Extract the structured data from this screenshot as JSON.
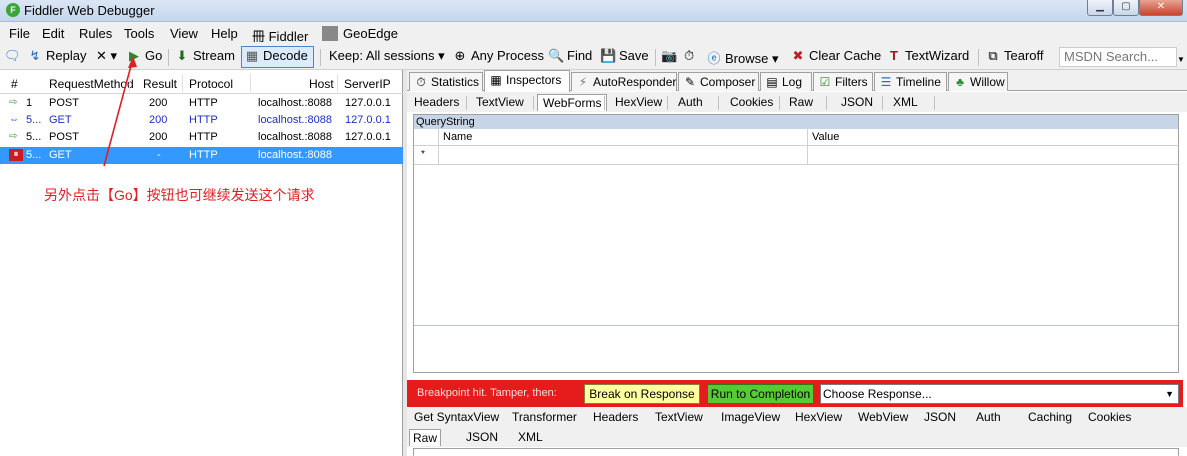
{
  "window": {
    "app_icon_letter": "F",
    "title": "Fiddler Web Debugger",
    "minimize": "▁",
    "maximize": "▢",
    "close": "✕"
  },
  "menu": {
    "items": [
      "File",
      "Edit",
      "Rules",
      "Tools",
      "View",
      "Help",
      "冊 Fiddler",
      "GeoEdge"
    ]
  },
  "toolbar": {
    "replay": "Replay",
    "remove": "✕ ▾",
    "go": "Go",
    "stream": "Stream",
    "decode": "Decode",
    "keep": "Keep: All sessions ▾",
    "any_process": "Any Process",
    "find": "Find",
    "save": "Save",
    "browse": "Browse",
    "clear_cache": "Clear Cache",
    "textwizard": "TextWizard",
    "tearoff": "Tearoff",
    "msdn_placeholder": "MSDN Search..."
  },
  "sessions": {
    "columns": [
      "#",
      "RequestMethod",
      "Result",
      "Protocol",
      "Host",
      "ServerIP"
    ],
    "rows": [
      {
        "num": "1",
        "method": "POST",
        "result": "200",
        "protocol": "HTTP",
        "host": "localhost.:8088",
        "ip": "127.0.0.1"
      },
      {
        "num": "5...",
        "method": "GET",
        "result": "200",
        "protocol": "HTTP",
        "host": "localhost.:8088",
        "ip": "127.0.0.1"
      },
      {
        "num": "5...",
        "method": "POST",
        "result": "200",
        "protocol": "HTTP",
        "host": "localhost.:8088",
        "ip": "127.0.0.1"
      },
      {
        "num": "5...",
        "method": "GET",
        "result": "-",
        "protocol": "HTTP",
        "host": "localhost.:8088",
        "ip": ""
      }
    ]
  },
  "annotation": "另外点击【Go】按钮也可继续发送这个请求",
  "top_tabs": [
    "Statistics",
    "Inspectors",
    "AutoResponder",
    "Composer",
    "Log",
    "Filters",
    "Timeline",
    "Willow"
  ],
  "request_tabs": [
    "Headers",
    "TextView",
    "WebForms",
    "HexView",
    "Auth",
    "Cookies",
    "Raw",
    "JSON",
    "XML"
  ],
  "querystring": {
    "title": "QueryString",
    "col_name": "Name",
    "col_value": "Value",
    "new_row_marker": "*"
  },
  "breakpoint": {
    "text": "Breakpoint hit. Tamper, then:",
    "break_on_response": "Break on Response",
    "run_to_completion": "Run to Completion",
    "choose_response": "Choose Response..."
  },
  "response_tabs": [
    "Get SyntaxView",
    "Transformer",
    "Headers",
    "TextView",
    "ImageView",
    "HexView",
    "WebView",
    "JSON",
    "Auth",
    "Caching",
    "Cookies"
  ],
  "response_subtabs": [
    "Raw",
    "JSON",
    "XML"
  ],
  "colors": {
    "selected_row": "#3399ff",
    "breakpoint_bar": "#e61c1c",
    "annotation": "#e02020"
  }
}
